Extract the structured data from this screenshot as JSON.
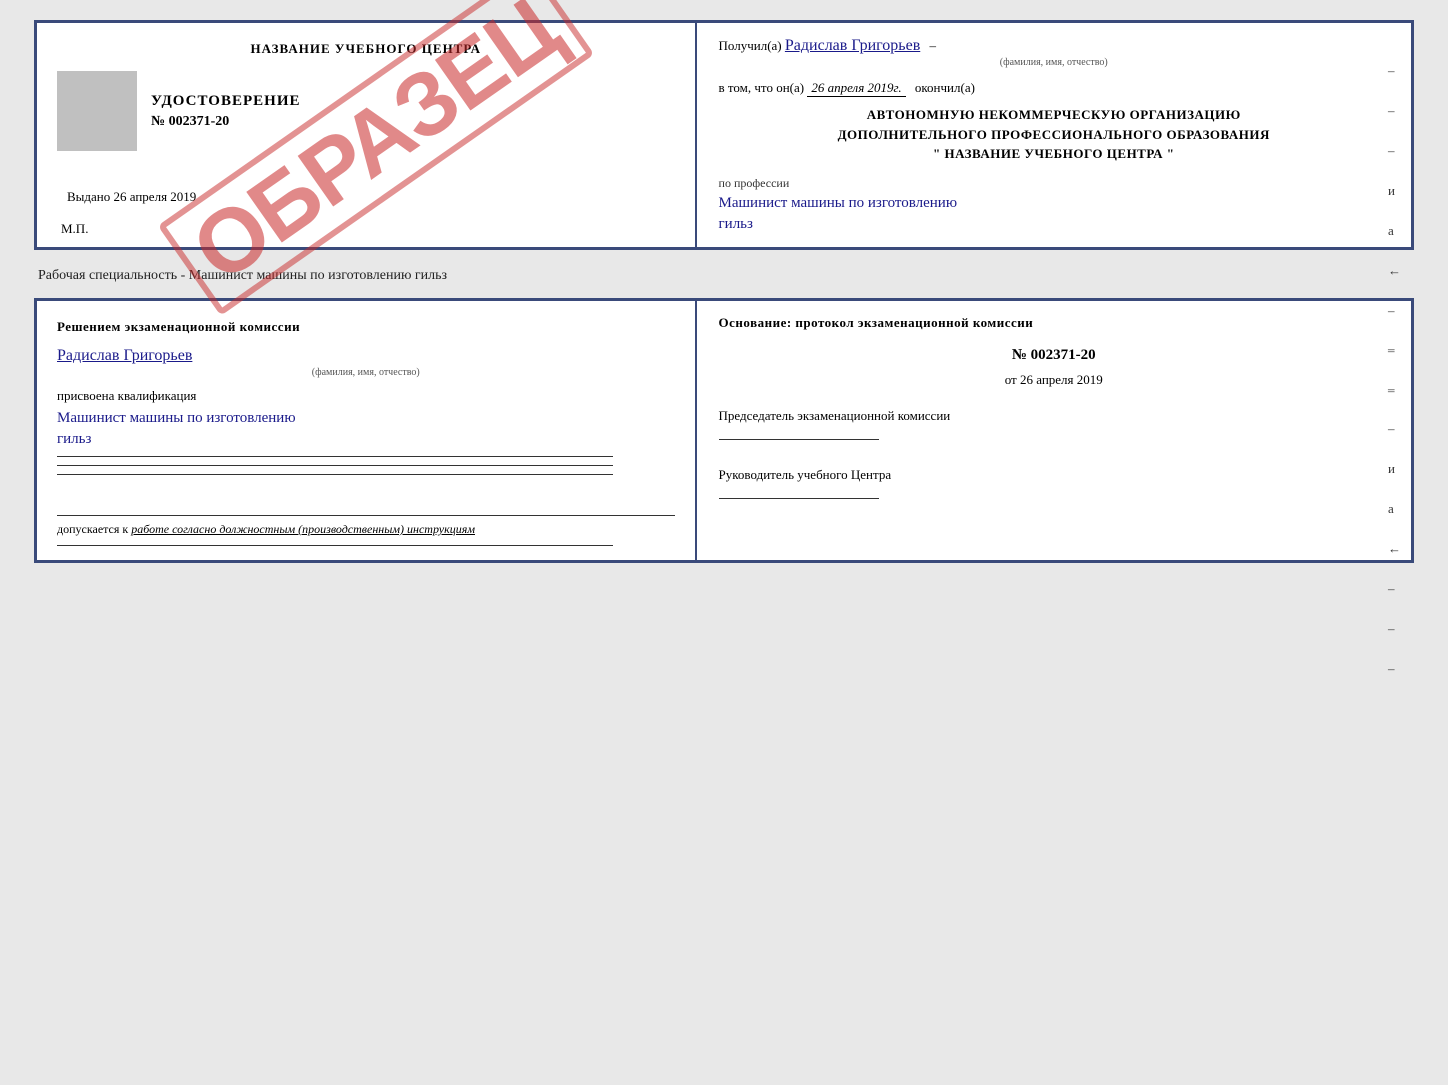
{
  "top_cert": {
    "left": {
      "title": "НАЗВАНИЕ УЧЕБНОГО ЦЕНТРА",
      "gray_box": true,
      "udostoverenie_label": "УДОСТОВЕРЕНИЕ",
      "number": "№ 002371-20",
      "vibdano_label": "Выдано",
      "vibdano_date": "26 апреля 2019",
      "mp_label": "М.П.",
      "obrazets": "ОБРАЗЕЦ"
    },
    "right": {
      "poluchil_label": "Получил(а)",
      "recipient_name": "Радислав Григорьев",
      "name_subtitle": "(фамилия, имя, отчество)",
      "dash": "–",
      "vtom_label": "в том, что он(а)",
      "vtom_date": "26 апреля 2019г.",
      "okончил_label": "окончил(а)",
      "org_line1": "АВТОНОМНУЮ НЕКОММЕРЧЕСКУЮ ОРГАНИЗАЦИЮ",
      "org_line2": "ДОПОЛНИТЕЛЬНОГО ПРОФЕССИОНАЛЬНОГО ОБРАЗОВАНИЯ",
      "org_line3": "\" НАЗВАНИЕ УЧЕБНОГО ЦЕНТРА \"",
      "profession_label": "по профессии",
      "profession_name": "Машинист машины по изготовлению",
      "profession_name2": "гильз",
      "side_dashes": [
        "–",
        "–",
        "–",
        "и",
        "а",
        "←",
        "–",
        "–",
        "–"
      ]
    }
  },
  "separator": {
    "text": "Рабочая специальность - Машинист машины по изготовлению гильз"
  },
  "bottom_cert": {
    "left": {
      "decision_title": "Решением экзаменационной комиссии",
      "recipient_name": "Радислав Григорьев",
      "name_subtitle": "(фамилия, имя, отчество)",
      "prisvoyena_label": "присвоена квалификация",
      "qualification": "Машинист машины по изготовлению",
      "qualification2": "гильз",
      "dopuskaetsya_label": "допускается к",
      "dopusk_text": "работе согласно должностным (производственным) инструкциям"
    },
    "right": {
      "osnovaniye_title": "Основание: протокол экзаменационной комиссии",
      "protocol_number": "№ 002371-20",
      "ot_label": "от",
      "ot_date": "26 апреля 2019",
      "predsedatel_label": "Председатель экзаменационной комиссии",
      "rukovoditel_label": "Руководитель учебного Центра",
      "side_items": [
        "–",
        "–",
        "–",
        "и",
        "а",
        "←",
        "–",
        "–",
        "–"
      ]
    }
  }
}
